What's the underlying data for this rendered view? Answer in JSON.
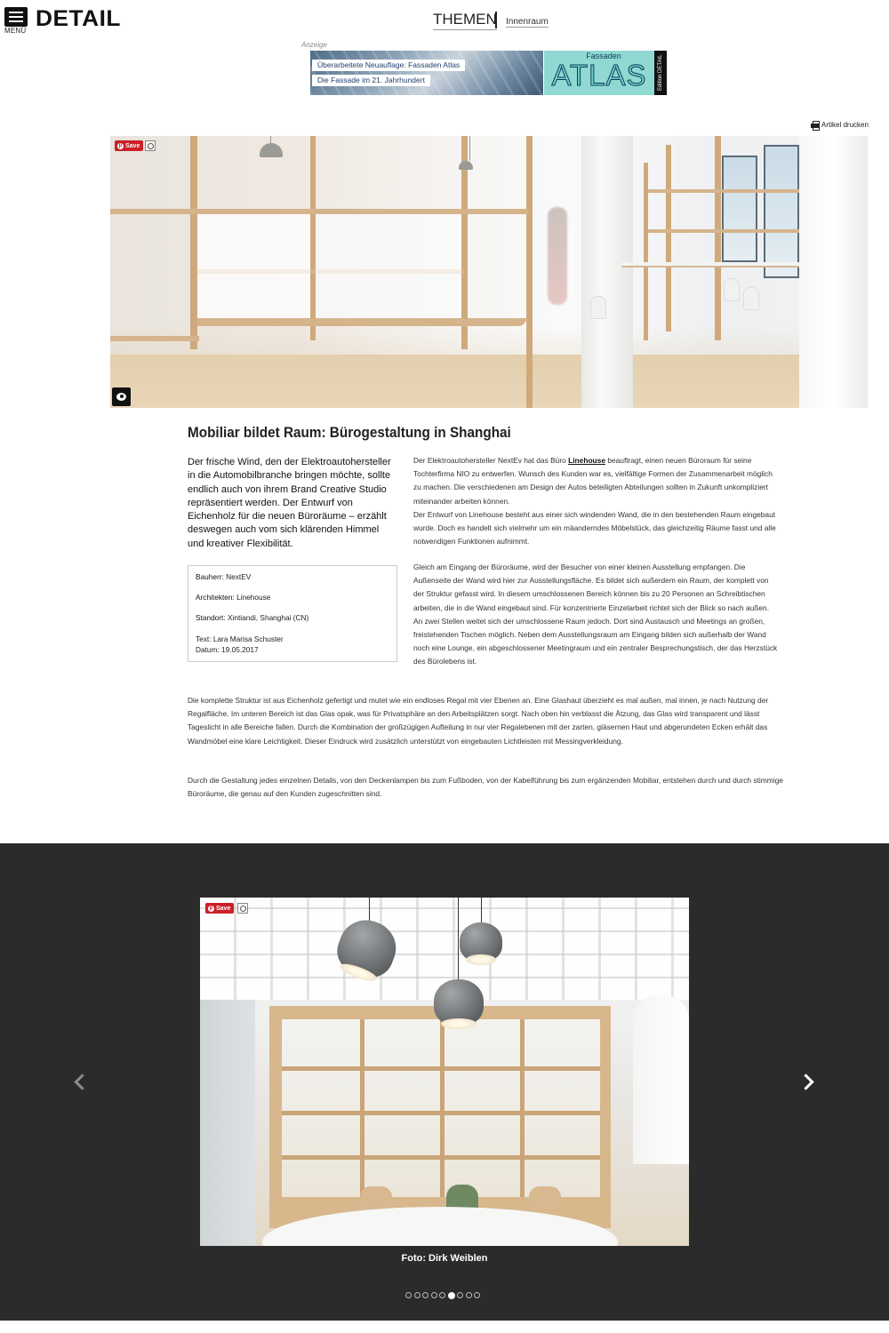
{
  "header": {
    "menu_label": "MENÜ",
    "logo": "DETAIL",
    "themen": "THEMEN",
    "category": "Innenraum"
  },
  "ad": {
    "label": "Anzeige",
    "line1": "Überarbeitete Neuauflage: Fassaden Atlas",
    "line2": "Die Fassade im 21. Jahrhundert",
    "brand_small": "Fassaden",
    "brand_big": "ATLAS",
    "edition": "Edition DETAIL"
  },
  "print_label": "Artikel drucken",
  "badges": {
    "save": "Save"
  },
  "article": {
    "title": "Mobiliar bildet Raum: Bürogestaltung in Shanghai",
    "lead": "Der frische Wind, den der Elektroautohersteller in die Automobilbranche bringen möchte, sollte endlich auch von ihrem Brand Creative Studio repräsentiert werden. Der Entwurf von Eichenholz für die neuen Büroräume – erzählt deswegen auch vom sich klärenden Himmel und kreativer Flexibilität.",
    "facts": {
      "bauherr_label": "Bauherr:",
      "bauherr": "NextEV",
      "architekten_label": "Architekten:",
      "architekten": "Linehouse",
      "standort_label": "Standort:",
      "standort": "Xintiandi, Shanghai (CN)",
      "text": "Text: Lara Marisa Schuster",
      "datum": "Datum: 19.05.2017"
    },
    "p1_before": "Der Elektroautohersteller NextEv hat das Büro ",
    "p1_link": "Linehouse",
    "p1_after": " beauftragt, einen neuen Büroraum für seine Tochterfirma NIO zu entwerfen. Wunsch des Kunden war es, vielfältige Formen der Zusammenarbeit möglich zu machen. Die verschiedenen am Design der Autos beteiligten Abteilungen sollten in Zukunft unkompliziert miteinander arbeiten können.",
    "p1b": "Der Entwurf von Linehouse besteht aus einer sich windenden Wand, die in den bestehenden Raum eingebaut wurde. Doch es handelt sich vielmehr um ein mäanderndes Möbelstück, das gleichzeitig Räume fasst und alle notwendigen Funktionen aufnimmt.",
    "p2": "Gleich am Eingang der Büroräume, wird der Besucher von einer kleinen Ausstellung empfangen. Die Außenseite der Wand wird hier zur Ausstellungsfläche. Es bildet sich außerdem ein Raum, der komplett von der Struktur gefasst wird. In diesem umschlossenen Bereich können bis zu 20 Personen an Schreibtischen arbeiten, die in die Wand eingebaut sind. Für konzentrierte Einzelarbeit richtet sich der Blick so nach außen. An zwei Stellen weitet sich der umschlossene Raum jedoch. Dort sind Austausch und Meetings an großen, freistehenden Tischen möglich. Neben dem Ausstellungsraum am Eingang bilden sich außerhalb der Wand noch eine Lounge, ein abgeschlossener Meetingraum und ein zentraler Besprechungstisch, der das Herzstück des Bürolebens ist.",
    "p3": "Die komplette Struktur ist aus Eichenholz gefertigt und mutet wie ein endloses Regal mit vier Ebenen an. Eine Glashaut überzieht es mal außen, mal innen, je nach Nutzung der Regalfläche. Im unteren Bereich ist das Glas opak, was für Privatsphäre an den Arbeitsplätzen sorgt. Nach oben hin verblasst die Ätzung, das Glas wird transparent und lässt Tageslicht in alle Bereiche fallen. Durch die Kombination der großzügigen Aufteilung in nur vier Regalebenen mit der zarten, gläsernen Haut und abgerundeten Ecken erhält das Wandmöbel eine klare Leichtigkeit. Dieser Eindruck wird zusätzlich unterstützt von eingebauten Lichtleisten mit Messingverkleidung.",
    "p4": "Durch die Gestaltung jedes einzelnen Details, von den Deckenlampen bis zum Fußboden, von der Kabelführung bis zum ergänzenden Mobiliar, entstehen durch und durch stimmige Büroräume, die genau auf den Kunden zugeschnitten sind."
  },
  "gallery": {
    "caption": "Foto: Dirk Weiblen",
    "total": 9,
    "active_index": 5
  }
}
